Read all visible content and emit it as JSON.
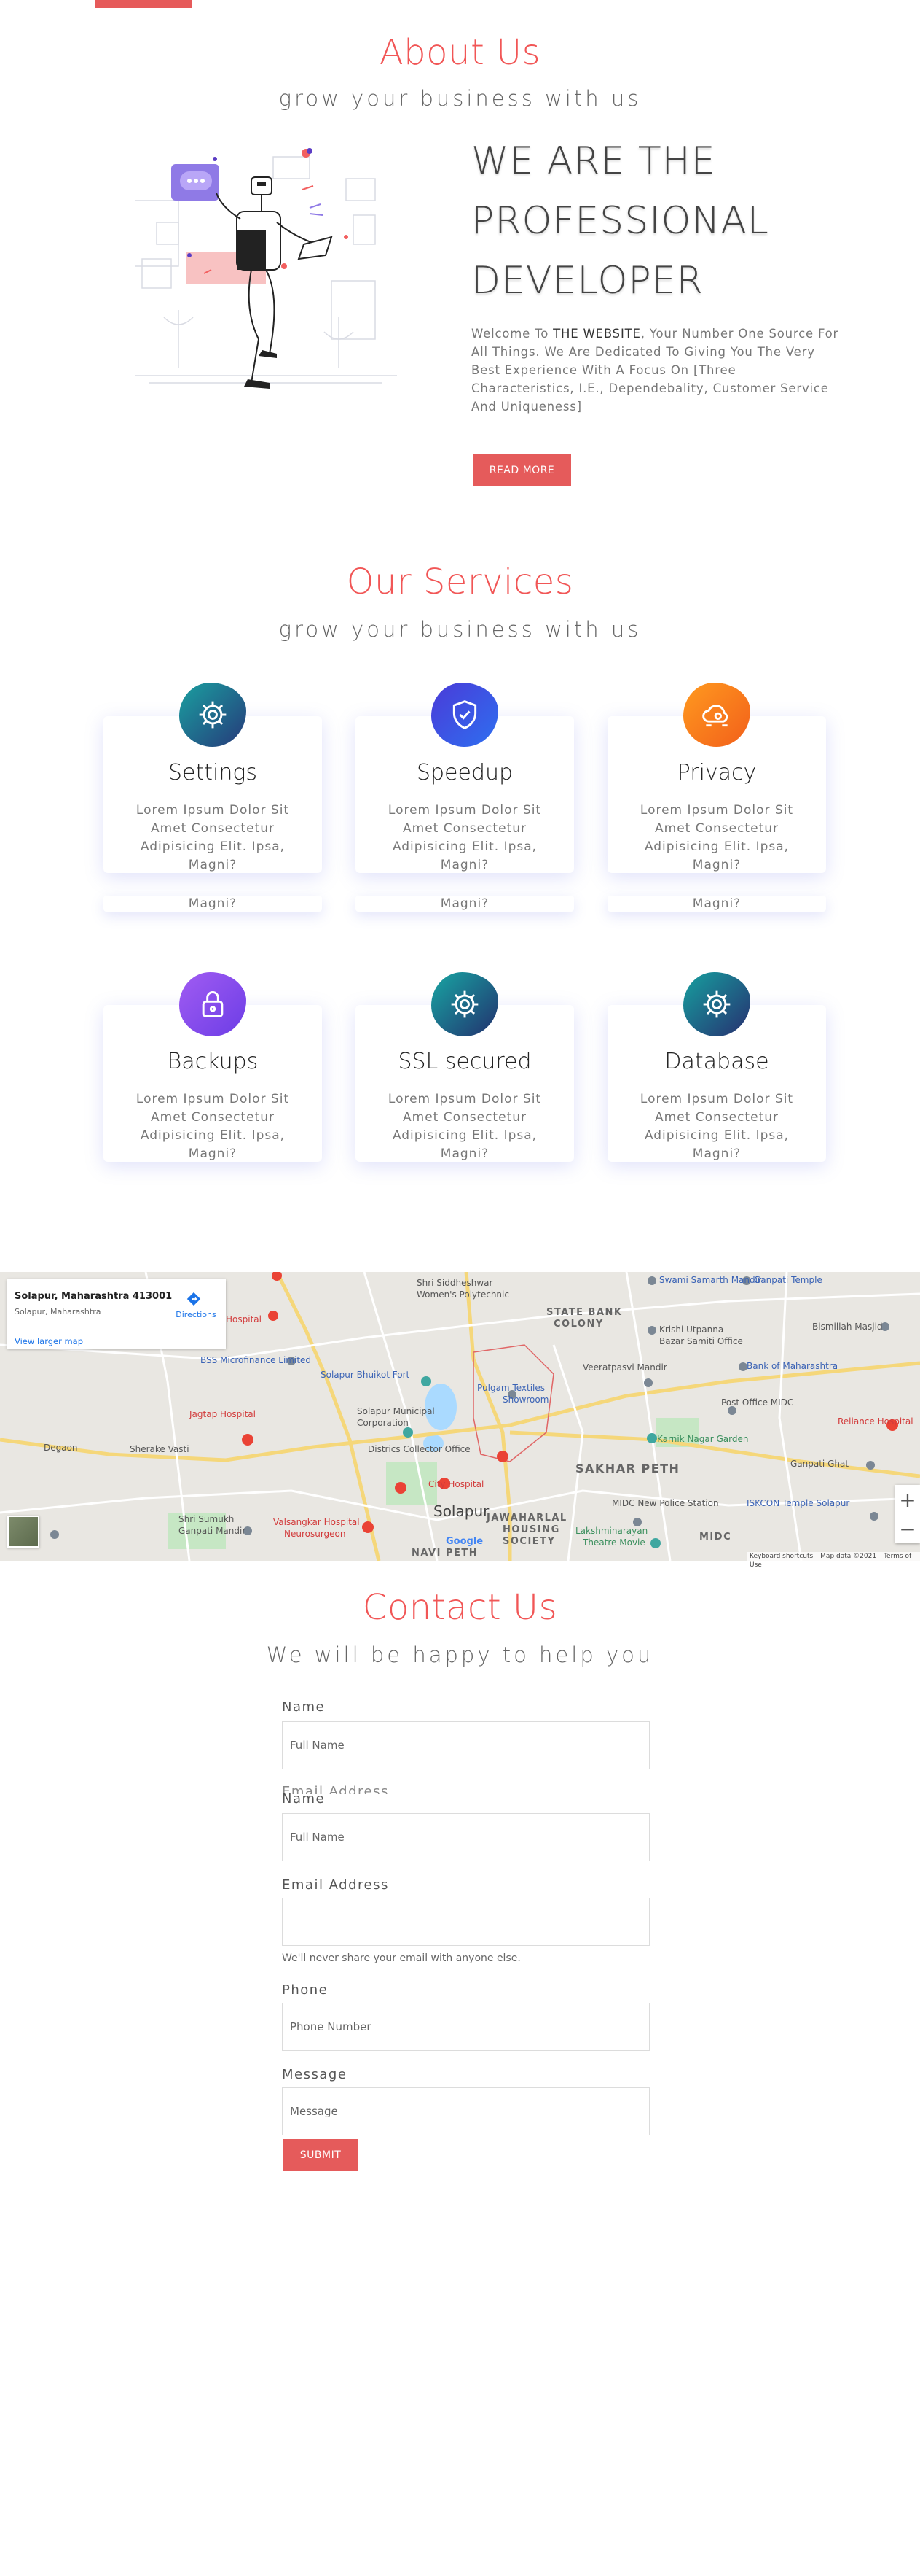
{
  "about": {
    "title": "About Us",
    "subtitle": "grow your business with us",
    "heading_lines": [
      "WE ARE THE",
      "PROFESSIONAL",
      "DEVELOPER"
    ],
    "text_before": "Welcome To ",
    "brand": "THE WEBSITE",
    "text_after": ", Your Number One Source For All Things. We Are Dedicated To Giving You The Very Best Experience With A Focus On [Three Characteristics, I.E., Dependebality, Customer Service And Uniqueness]",
    "button": "READ MORE"
  },
  "services": {
    "title": "Our Services",
    "subtitle": "grow your business with us",
    "cards": [
      {
        "title": "Settings",
        "icon": "gear-icon",
        "desc": "Lorem Ipsum Dolor Sit Amet Consectetur Adipisicing Elit. Ipsa, Magni?"
      },
      {
        "title": "Speedup",
        "icon": "shield-icon",
        "desc": "Lorem Ipsum Dolor Sit Amet Consectetur Adipisicing Elit. Ipsa, Magni?"
      },
      {
        "title": "Privacy",
        "icon": "cloud-gear-icon",
        "desc": "Lorem Ipsum Dolor Sit Amet Consectetur Adipisicing Elit. Ipsa, Magni?"
      },
      {
        "title": "Backups",
        "icon": "lock-icon",
        "desc": "Lorem Ipsum Dolor Sit Amet Consectetur Adipisicing Elit. Ipsa, Magni?"
      },
      {
        "title": "SSL secured",
        "icon": "gear-icon",
        "desc": "Lorem Ipsum Dolor Sit Amet Consectetur Adipisicing Elit. Ipsa, Magni?"
      },
      {
        "title": "Database",
        "icon": "gear-icon",
        "desc": "Lorem Ipsum Dolor Sit Amet Consectetur Adipisicing Elit. Ipsa, Magni?"
      }
    ],
    "overflow_text": "Magni?"
  },
  "map": {
    "place": "Solapur, Maharashtra 413001",
    "address": "Solapur, Maharashtra",
    "directions": "Directions",
    "larger_map": "View larger map",
    "zoom_in": "+",
    "zoom_out": "−",
    "footer": [
      "Keyboard shortcuts",
      "Map data ©2021",
      "Terms of Use"
    ],
    "logo": "Google",
    "labels": {
      "shri_siddheshwar": "Shri Siddheshwar",
      "womens_polytechnic": "Women's Polytechnic",
      "state_bank_colony": "STATE BANK",
      "colony": "COLONY",
      "swami_samarth": "Swami Samarth Mandir",
      "ganpati_temple": "Ganpati Temple",
      "krishi": "Krishi Utpanna",
      "bazar": "Bazar Samiti Office",
      "bismillah": "Bismillah Masjid",
      "bss": "BSS Microfinance Limited",
      "bhuikot": "Solapur Bhuikot Fort",
      "veerat": "Veeratpasvi Mandir",
      "bank_maha": "Bank of Maharashtra",
      "pulgam": "Pulgam Textiles",
      "showroom": "Showroom",
      "post_office": "Post Office MIDC",
      "reliance": "Reliance Hospital",
      "jagtap": "Jagtap Hospital",
      "municipal": "Solapur Municipal",
      "corporation": "Corporation",
      "karnik": "Karnik Nagar Garden",
      "degaon": "Degaon",
      "sherake": "Sherake Vasti",
      "collector": "Districs Collector Office",
      "ganpati_ghat": "Ganpati Ghat",
      "sakhar_peth": "SAKHAR PETH",
      "city_hospital": "City Hospital",
      "midc_station": "MIDC New Police Station",
      "iskcon": "ISKCON Temple Solapur",
      "shri_sumukh": "Shri Sumukh",
      "ganpati_mandir": "Ganpati Mandir",
      "valsangkar": "Valsangkar Hospital",
      "neurosurgeon": "Neurosurgeon",
      "solapur": "Solapur",
      "jawaharlal": "JAWAHARLAL",
      "housing": "HOUSING",
      "society": "SOCIETY",
      "lakshmi": "Lakshminarayan",
      "theatre": "Theatre Movie",
      "midc": "MIDC",
      "navi_peth": "NAVI PETH",
      "hospital": "Hospital"
    },
    "colors": {
      "road_major": "#f5d77a",
      "road_minor": "#ffffff",
      "water": "#aadaff",
      "park": "#c6e7c4",
      "pin_red": "#ea4335",
      "pin_teal": "#3fa7a0",
      "pin_gray": "#7b8794"
    }
  },
  "contact": {
    "title": "Contact Us",
    "subtitle": "We will be happy to help you",
    "ghost_label": "Email Address",
    "fields": {
      "name1_label": "Name",
      "name1_placeholder": "Full Name",
      "name2_label": "Name",
      "name2_placeholder": "Full Name",
      "email_label": "Email Address",
      "email_placeholder": "",
      "email_note": "We'll never share your email with anyone else.",
      "phone_label": "Phone",
      "phone_placeholder": "Phone Number",
      "message_label": "Message",
      "message_placeholder": "Message"
    },
    "submit": "SUBMIT"
  },
  "theme": {
    "accent": "#e55b5b",
    "heading_red": "#f15656"
  }
}
